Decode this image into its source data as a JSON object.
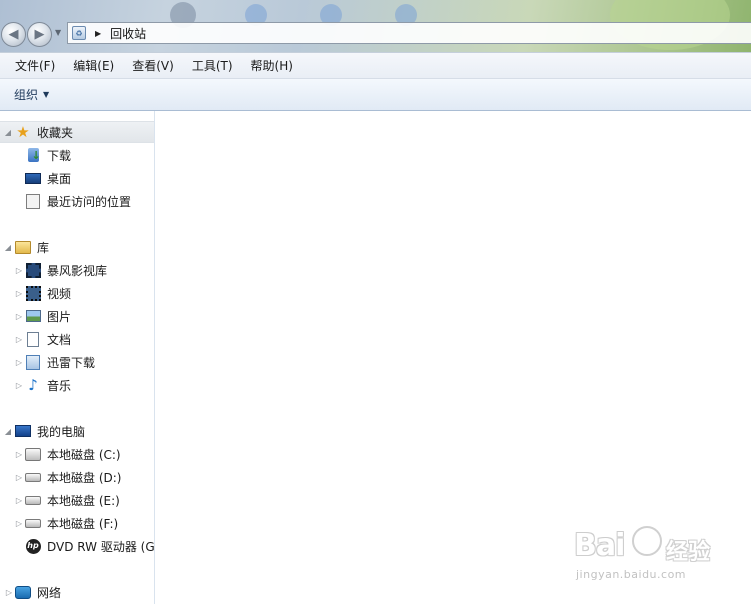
{
  "address_bar": {
    "location": "回收站",
    "location_icon": "recycle-bin-icon"
  },
  "menu": {
    "items": [
      {
        "label": "文件(F)"
      },
      {
        "label": "编辑(E)"
      },
      {
        "label": "查看(V)"
      },
      {
        "label": "工具(T)"
      },
      {
        "label": "帮助(H)"
      }
    ]
  },
  "command_bar": {
    "organize_label": "组织"
  },
  "navigation": {
    "favorites": {
      "label": "收藏夹",
      "icon": "star-icon",
      "items": [
        {
          "label": "下载",
          "icon": "downloads-icon"
        },
        {
          "label": "桌面",
          "icon": "desktop-icon"
        },
        {
          "label": "最近访问的位置",
          "icon": "recent-places-icon"
        }
      ]
    },
    "libraries": {
      "label": "库",
      "icon": "library-icon",
      "items": [
        {
          "label": "暴风影视库",
          "icon": "film-library-icon"
        },
        {
          "label": "视频",
          "icon": "video-icon"
        },
        {
          "label": "图片",
          "icon": "picture-icon"
        },
        {
          "label": "文档",
          "icon": "document-icon"
        },
        {
          "label": "迅雷下载",
          "icon": "xunlei-download-icon"
        },
        {
          "label": "音乐",
          "icon": "music-icon"
        }
      ]
    },
    "computer": {
      "label": "我的电脑",
      "icon": "computer-icon",
      "items": [
        {
          "label": "本地磁盘 (C:)",
          "icon": "windows-drive-icon"
        },
        {
          "label": "本地磁盘 (D:)",
          "icon": "drive-icon"
        },
        {
          "label": "本地磁盘 (E:)",
          "icon": "drive-icon"
        },
        {
          "label": "本地磁盘 (F:)",
          "icon": "drive-icon"
        },
        {
          "label": "DVD RW 驱动器 (G",
          "icon": "dvd-drive-icon"
        }
      ]
    },
    "network": {
      "label": "网络",
      "icon": "network-icon"
    }
  },
  "watermark": {
    "brand": "Bai",
    "brand_suffix": "经验",
    "url": "jingyan.baidu.com"
  }
}
